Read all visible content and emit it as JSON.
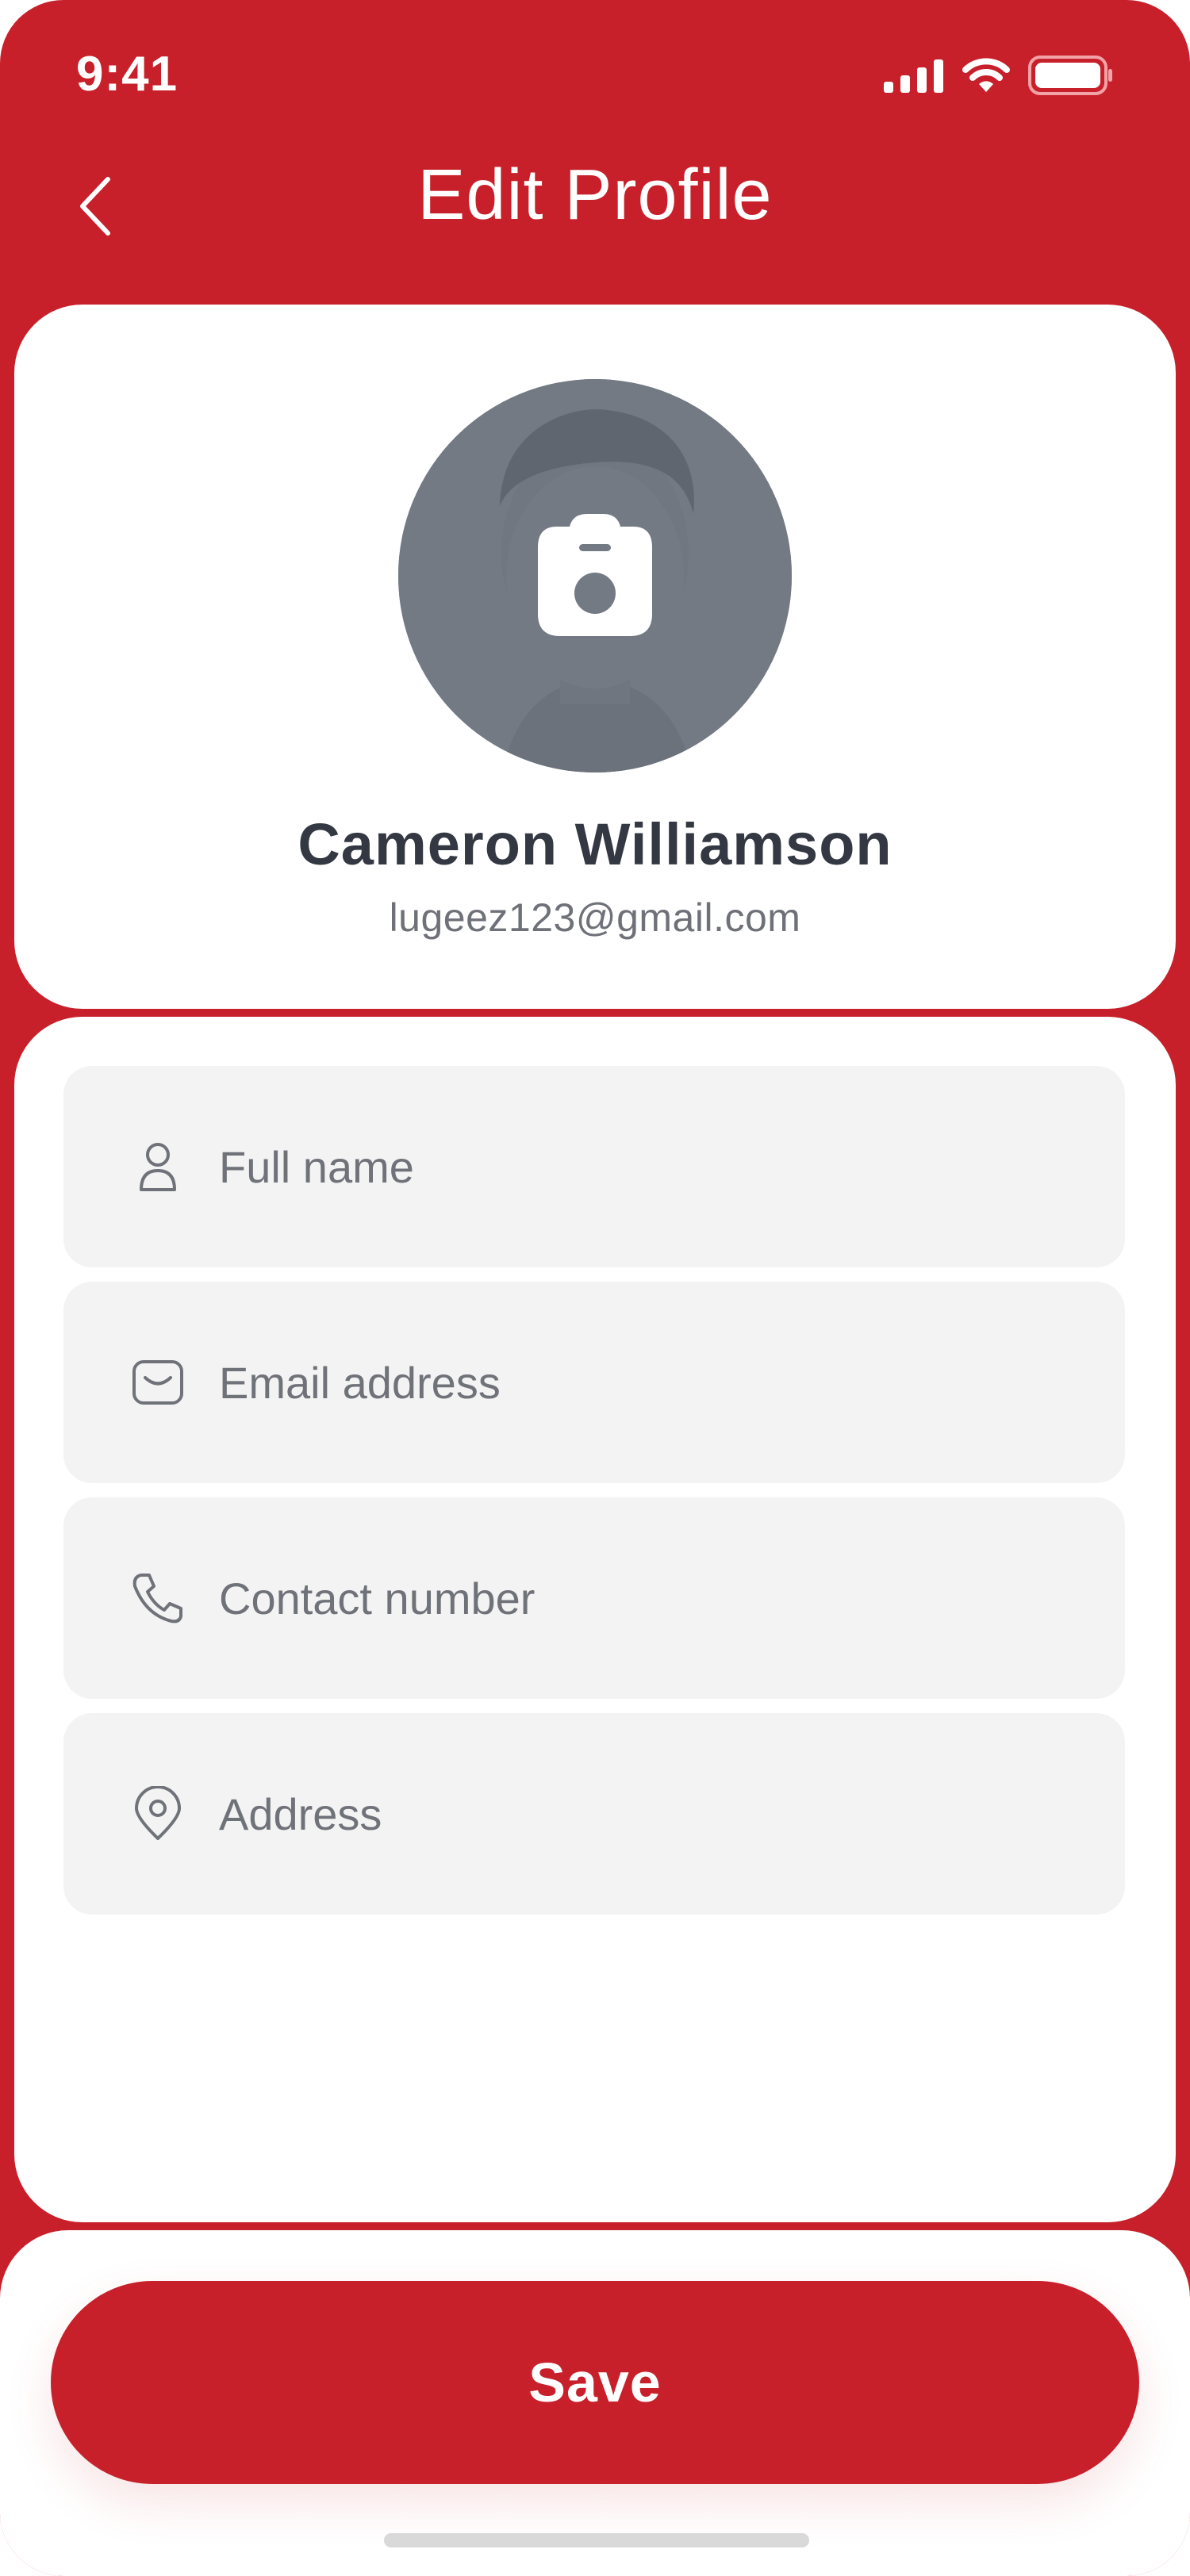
{
  "colors": {
    "brand": "#c8202a",
    "card": "#ffffff",
    "field_bg": "#f3f3f3",
    "name_text": "#333842",
    "muted_text": "#6e7178"
  },
  "status_bar": {
    "time": "9:41",
    "icons": [
      "cellular-signal-icon",
      "wifi-icon",
      "battery-icon"
    ]
  },
  "header": {
    "title": "Edit Profile",
    "back_icon": "chevron-left-icon"
  },
  "profile": {
    "name": "Cameron Williamson",
    "email": "lugeez123@gmail.com",
    "avatar_overlay_icon": "camera-icon"
  },
  "form": {
    "fields": [
      {
        "icon": "user-icon",
        "placeholder": "Full name",
        "value": ""
      },
      {
        "icon": "mail-icon",
        "placeholder": "Email address",
        "value": ""
      },
      {
        "icon": "phone-icon",
        "placeholder": "Contact number",
        "value": ""
      },
      {
        "icon": "location-pin-icon",
        "placeholder": "Address",
        "value": ""
      }
    ]
  },
  "actions": {
    "save_label": "Save"
  }
}
